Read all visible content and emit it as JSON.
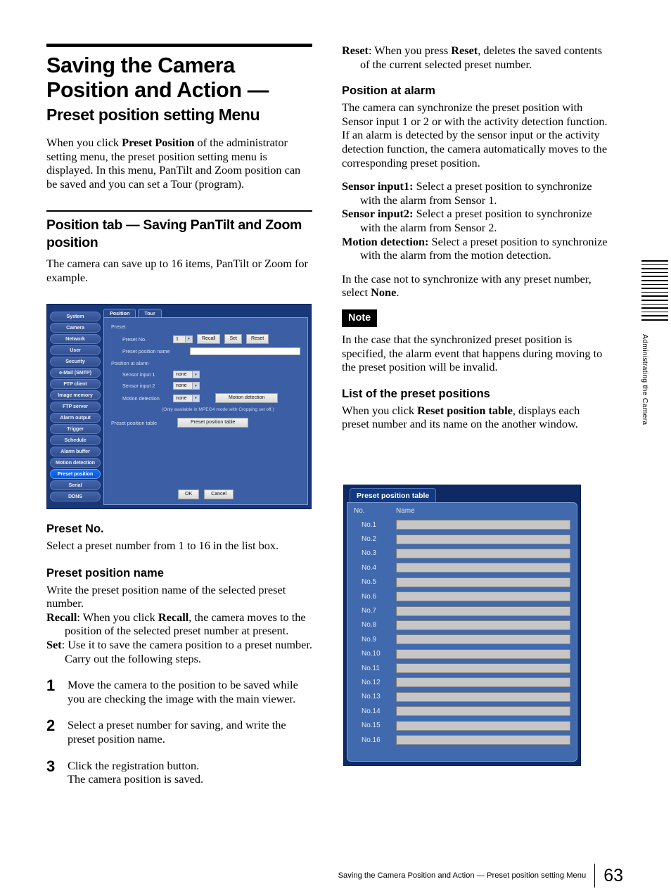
{
  "document": {
    "footer_text": "Saving the Camera Position and Action — Preset position setting Menu",
    "page_number": "63",
    "edge_tab_label": "Administrating the Camera"
  },
  "left_column": {
    "title_main": "Saving the Camera Position and Action —",
    "title_sub": "Preset position setting Menu",
    "intro_1": "When you click ",
    "intro_bold": "Preset Position",
    "intro_2": " of the administrator setting menu, the preset position setting menu is displayed. In this menu, PanTilt and Zoom position can be saved and you can set a Tour (program).",
    "section_heading": "Position tab — Saving PanTilt and Zoom position",
    "section_body": "The camera can save up to 16 items, PanTilt or Zoom for example.",
    "preset_no_heading": "Preset No.",
    "preset_no_body": "Select a preset number from 1 to 16 in the list box.",
    "preset_name_heading": "Preset position name",
    "preset_name_body": "Write the preset position name of the selected preset number.",
    "recall_label": "Recall",
    "recall_text_1": ": When you click ",
    "recall_bold": "Recall",
    "recall_text_2": ", the camera moves to the position of the selected preset number at present.",
    "set_label": "Set",
    "set_text": ": Use it to save the camera position to a preset number.",
    "set_text_2": "Carry out the following steps.",
    "steps": [
      {
        "num": "1",
        "text": "Move the camera to the position to be saved while you are checking the image with the main viewer."
      },
      {
        "num": "2",
        "text": "Select a preset number for saving, and write the preset position name."
      },
      {
        "num": "3",
        "text": "Click the registration button.\nThe camera position is saved."
      }
    ]
  },
  "right_column": {
    "reset_bold": "Reset",
    "reset_text_1": ": When you press ",
    "reset_bold_2": "Reset",
    "reset_text_2": ", deletes the saved contents of the current selected preset number.",
    "position_alarm_heading": "Position at alarm",
    "position_alarm_body_1": "The camera can synchronize the preset position with Sensor input 1 or 2 or with the activity detection function.",
    "position_alarm_body_2": "If an alarm is detected by the sensor input or the activity detection function, the camera automatically moves to the corresponding preset position.",
    "sensor1_label": "Sensor input1:",
    "sensor1_text": " Select a preset position to synchronize with the alarm from Sensor 1.",
    "sensor2_label": "Sensor input2:",
    "sensor2_text": " Select a preset position to synchronize with the alarm from Sensor 2.",
    "motion_label": "Motion detection:",
    "motion_text": " Select a preset position to synchronize with the alarm from the motion detection.",
    "none_text_1": "In the case not to synchronize with any preset number, select ",
    "none_bold": "None",
    "none_text_2": ".",
    "note_badge": "Note",
    "note_body": "In the case that the synchronized preset position is specified, the alarm event that happens during moving to the preset position will be invalid.",
    "list_heading": "List of the preset positions",
    "list_body_1": "When you click ",
    "list_body_bold": "Reset position table",
    "list_body_2": ", displays each preset number and its name on the another window."
  },
  "app_screenshot": {
    "sidebar": [
      {
        "label": "System",
        "active": false
      },
      {
        "label": "Camera",
        "active": false
      },
      {
        "label": "Network",
        "active": false
      },
      {
        "label": "User",
        "active": false
      },
      {
        "label": "Security",
        "active": false
      },
      {
        "label": "e-Mail (SMTP)",
        "active": false
      },
      {
        "label": "FTP client",
        "active": false
      },
      {
        "label": "Image memory",
        "active": false
      },
      {
        "label": "FTP server",
        "active": false
      },
      {
        "label": "Alarm output",
        "active": false
      },
      {
        "label": "Trigger",
        "active": false
      },
      {
        "label": "Schedule",
        "active": false
      },
      {
        "label": "Alarm buffer",
        "active": false
      },
      {
        "label": "Motion detection",
        "active": false
      },
      {
        "label": "Preset position",
        "active": true
      },
      {
        "label": "Serial",
        "active": false
      },
      {
        "label": "DDNS",
        "active": false
      }
    ],
    "tabs": [
      {
        "label": "Position",
        "active": true
      },
      {
        "label": "Tour",
        "active": false
      }
    ],
    "group_preset": "Preset",
    "preset_no_label": "Preset No.",
    "preset_no_value": "1",
    "btn_recall": "Recall",
    "btn_set": "Set",
    "btn_reset": "Reset",
    "preset_name_label": "Preset position name",
    "preset_name_value": "",
    "group_position_alarm": "Position at alarm",
    "sensor1_label": "Sensor input 1",
    "sensor1_value": "none",
    "sensor2_label": "Sensor input 2",
    "sensor2_value": "none",
    "motion_label": "Motion detection",
    "motion_value": "none",
    "btn_motion_detection": "Motion detection",
    "hint": "(Only available in MPEG4 mode with Cropping set off.)",
    "preset_table_label": "Preset position table",
    "btn_preset_table": "Preset position table",
    "btn_ok": "OK",
    "btn_cancel": "Cancel"
  },
  "preset_position_table": {
    "window_title": "Preset position table",
    "col_no": "No.",
    "col_name": "Name",
    "rows": [
      {
        "no": "No.1",
        "name": ""
      },
      {
        "no": "No.2",
        "name": ""
      },
      {
        "no": "No.3",
        "name": ""
      },
      {
        "no": "No.4",
        "name": ""
      },
      {
        "no": "No.5",
        "name": ""
      },
      {
        "no": "No.6",
        "name": ""
      },
      {
        "no": "No.7",
        "name": ""
      },
      {
        "no": "No.8",
        "name": ""
      },
      {
        "no": "No.9",
        "name": ""
      },
      {
        "no": "No.10",
        "name": ""
      },
      {
        "no": "No.11",
        "name": ""
      },
      {
        "no": "No.12",
        "name": ""
      },
      {
        "no": "No.13",
        "name": ""
      },
      {
        "no": "No.14",
        "name": ""
      },
      {
        "no": "No.15",
        "name": ""
      },
      {
        "no": "No.16",
        "name": ""
      }
    ]
  },
  "colors": {
    "ui_frame": "#18387a",
    "ui_panel": "#3c5ea5",
    "ui_active": "#0a53d8",
    "field": "#c6c6c6"
  }
}
